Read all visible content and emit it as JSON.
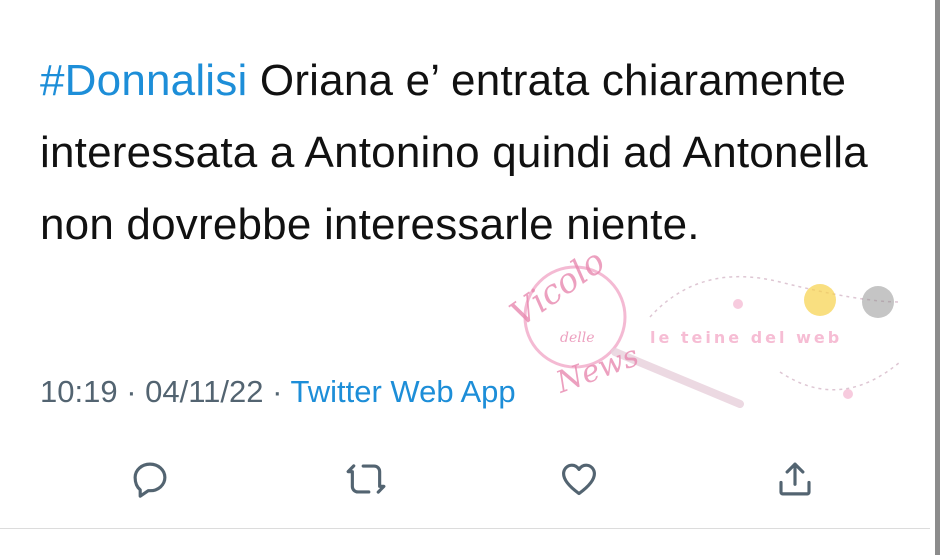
{
  "tweet": {
    "hashtag": "#Donnalisi",
    "body": " Oriana e’ entrata chiaramente interessata a Antonino quindi ad Antonella non dovrebbe interessarle niente."
  },
  "meta": {
    "time": "10:19",
    "separator_1": " · ",
    "date": "04/11/22",
    "separator_2": " · ",
    "source": "Twitter Web App"
  },
  "actions": {
    "reply_icon": "reply-icon",
    "retweet_icon": "retweet-icon",
    "like_icon": "heart-icon",
    "share_icon": "share-icon"
  },
  "watermark": {
    "script_line_1": "Vicolo",
    "script_line_2": "delle",
    "script_line_3": "News",
    "badge": "le teine del web"
  },
  "colors": {
    "link": "#1d8ed8",
    "text": "#111111",
    "meta": "#536471",
    "icon": "#536471"
  }
}
